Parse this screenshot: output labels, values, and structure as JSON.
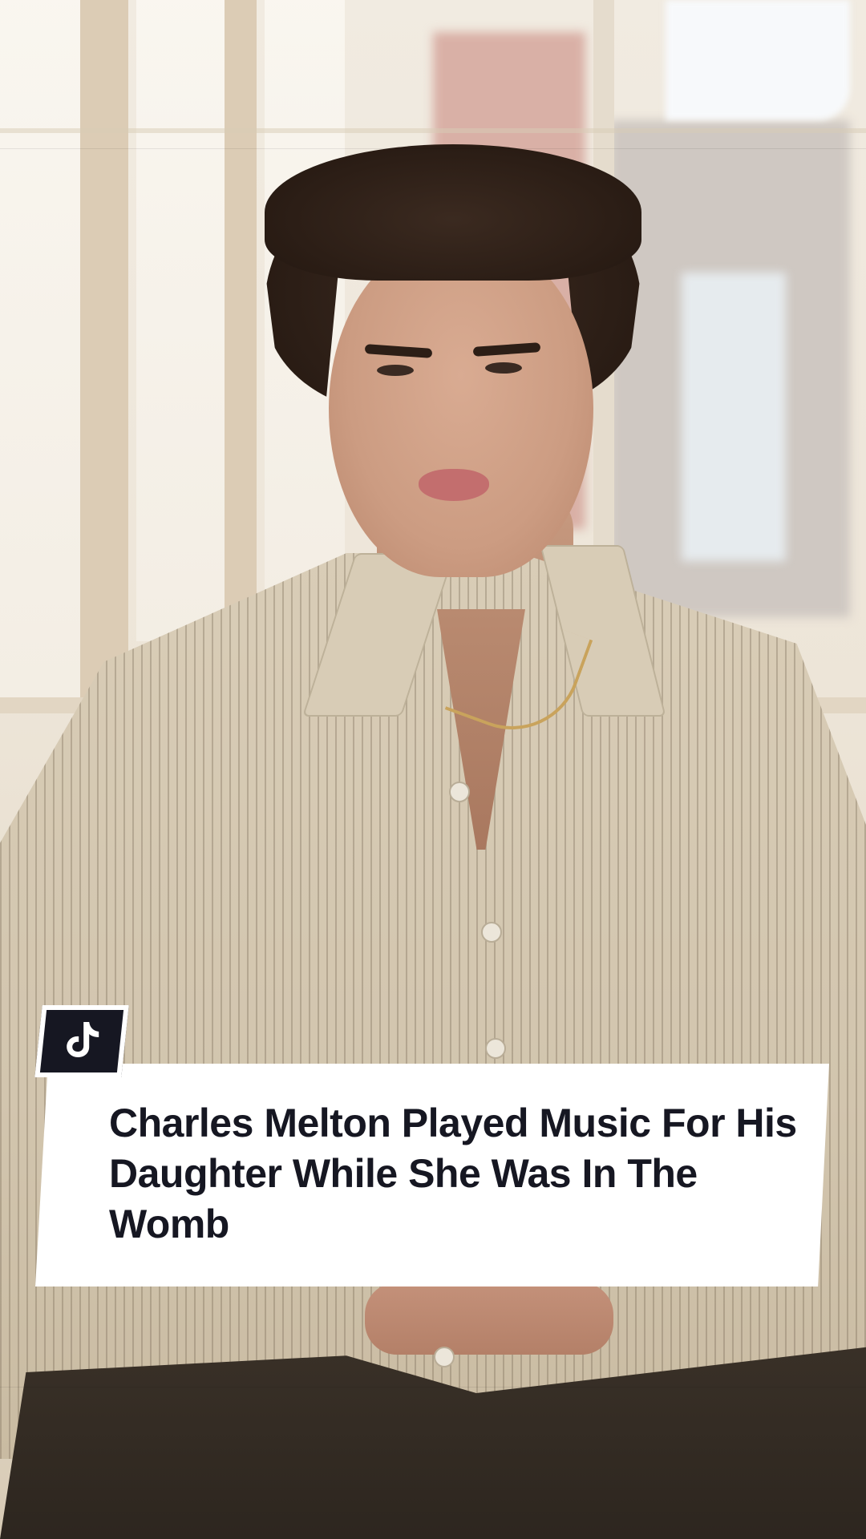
{
  "overlay": {
    "title": "Charles Melton Played Music For His Daughter While She Was In The Womb",
    "badge_icon": "tiktok-logo-icon"
  },
  "colors": {
    "card_background": "#ffffff",
    "title_text": "#161722",
    "badge_background": "#161722",
    "shirt": "#d5c9b2"
  }
}
